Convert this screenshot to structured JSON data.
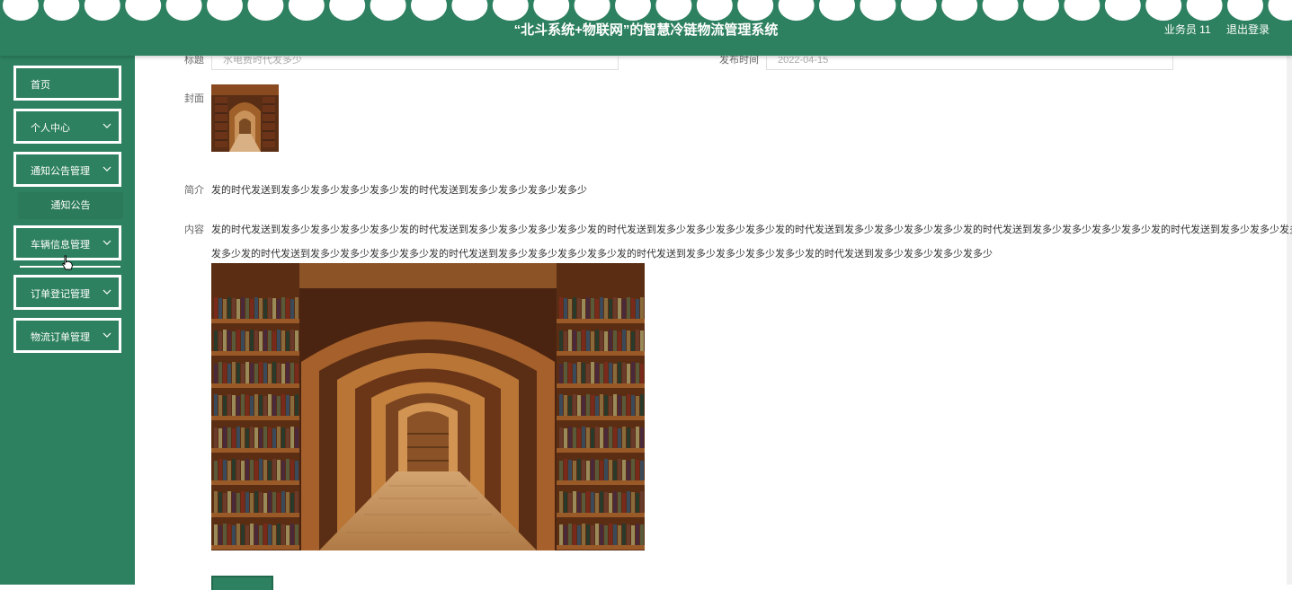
{
  "header": {
    "app_title": "“北斗系统+物联网”的智慧冷链物流管理系统",
    "username": "业务员 11",
    "logout_label": "退出登录"
  },
  "sidebar": {
    "items": [
      {
        "label": "首页"
      },
      {
        "label": "个人中心"
      },
      {
        "label": "通知公告管理"
      },
      {
        "label": "车辆信息管理"
      },
      {
        "label": "订单登记管理"
      },
      {
        "label": "物流订单管理"
      }
    ],
    "submenu": {
      "label": "通知公告"
    }
  },
  "form": {
    "title_label": "标题",
    "title_value": "水电费时代发多少",
    "date_label": "发布时间",
    "date_value": "2022-04-15",
    "cover_label": "封面",
    "desc_label": "简介",
    "desc_text": "发的时代发送到发多少发多少发多少发多少发的时代发送到发多少发多少发多少发多少",
    "content_label": "内容",
    "content_line1": "发的时代发送到发多少发多少发多少发多少发的时代发送到发多少发多少发多少发多少发的时代发送到发多少发多少发多少发多少发的时代发送到发多少发多少发多少发多少发的时代发送到发多少发多少发多少发多少发的时代发送到发多少发多少发多少",
    "content_line2": "发多少发的时代发送到发多少发多少发多少发多少发的时代发送到发多少发多少发多少发多少发的时代发送到发多少发多少发多少发多少发的时代发送到发多少发多少发多少发多少"
  },
  "colors": {
    "primary": "#2e8160",
    "white": "#ffffff"
  }
}
